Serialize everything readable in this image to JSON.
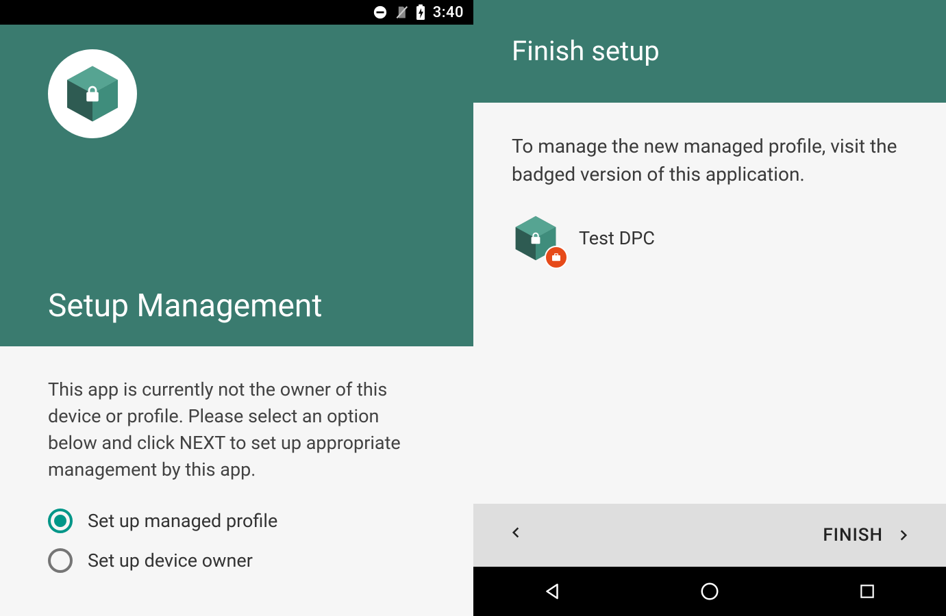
{
  "statusbar": {
    "time": "3:40"
  },
  "left": {
    "title": "Setup Management",
    "description": "This app is currently not the owner of this device or profile. Please select an option below and click NEXT to set up appropriate management by this app.",
    "options": [
      {
        "label": "Set up managed profile",
        "selected": true
      },
      {
        "label": "Set up device owner",
        "selected": false
      }
    ]
  },
  "right": {
    "title": "Finish setup",
    "description": "To manage the new managed profile, visit the badged version of this application.",
    "app_name": "Test DPC",
    "footer": {
      "finish_label": "FINISH"
    }
  },
  "colors": {
    "teal": "#3a7b6f",
    "accent": "#009688",
    "badge": "#e64a19"
  }
}
